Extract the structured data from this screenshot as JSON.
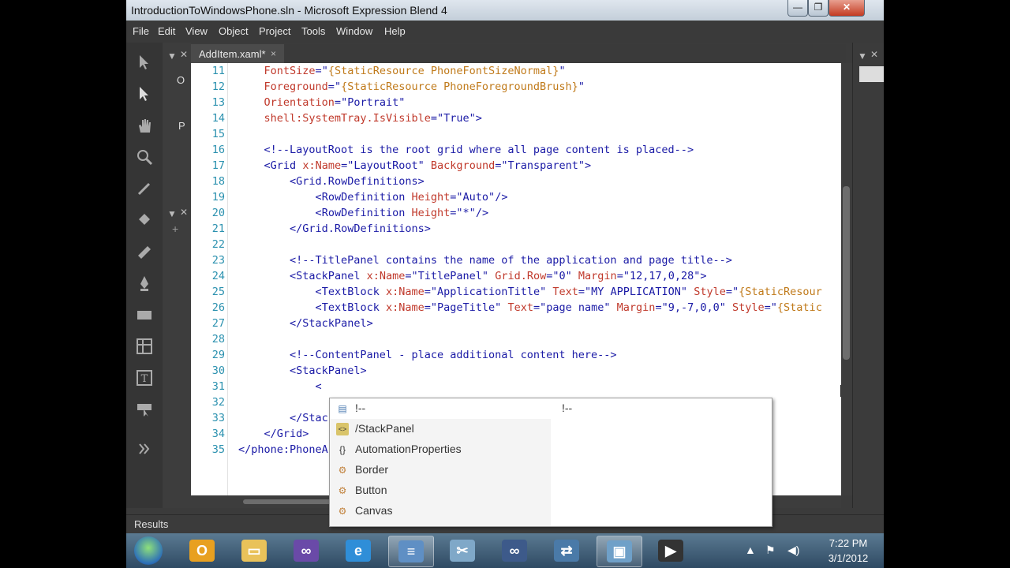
{
  "window": {
    "title": "IntroductionToWindowsPhone.sln - Microsoft Expression Blend 4",
    "controls": {
      "minimize": "—",
      "maximize": "❐",
      "close": "✕"
    }
  },
  "menu": [
    "File",
    "Edit",
    "View",
    "Object",
    "Project",
    "Tools",
    "Window",
    "Help"
  ],
  "left_panel": {
    "letter_1": "O",
    "letter_2": "P",
    "add": "+"
  },
  "document_tab": {
    "label": "AddItem.xaml*",
    "close": "×"
  },
  "code_lines": [
    {
      "num": "11",
      "text": "    FontSize=\"{StaticResource PhoneFontSizeNormal}\""
    },
    {
      "num": "12",
      "text": "    Foreground=\"{StaticResource PhoneForegroundBrush}\""
    },
    {
      "num": "13",
      "text": "    Orientation=\"Portrait\""
    },
    {
      "num": "14",
      "text": "    shell:SystemTray.IsVisible=\"True\">"
    },
    {
      "num": "15",
      "text": ""
    },
    {
      "num": "16",
      "text": "    <!--LayoutRoot is the root grid where all page content is placed-->"
    },
    {
      "num": "17",
      "text": "    <Grid x:Name=\"LayoutRoot\" Background=\"Transparent\">"
    },
    {
      "num": "18",
      "text": "        <Grid.RowDefinitions>"
    },
    {
      "num": "19",
      "text": "            <RowDefinition Height=\"Auto\"/>"
    },
    {
      "num": "20",
      "text": "            <RowDefinition Height=\"*\"/>"
    },
    {
      "num": "21",
      "text": "        </Grid.RowDefinitions>"
    },
    {
      "num": "22",
      "text": ""
    },
    {
      "num": "23",
      "text": "        <!--TitlePanel contains the name of the application and page title-->"
    },
    {
      "num": "24",
      "text": "        <StackPanel x:Name=\"TitlePanel\" Grid.Row=\"0\" Margin=\"12,17,0,28\">"
    },
    {
      "num": "25",
      "text": "            <TextBlock x:Name=\"ApplicationTitle\" Text=\"MY APPLICATION\" Style=\"{StaticResour"
    },
    {
      "num": "26",
      "text": "            <TextBlock x:Name=\"PageTitle\" Text=\"page name\" Margin=\"9,-7,0,0\" Style=\"{Static"
    },
    {
      "num": "27",
      "text": "        </StackPanel>"
    },
    {
      "num": "28",
      "text": ""
    },
    {
      "num": "29",
      "text": "        <!--ContentPanel - place additional content here-->"
    },
    {
      "num": "30",
      "text": "        <StackPanel>"
    },
    {
      "num": "31",
      "text": "            <"
    },
    {
      "num": "32",
      "text": ""
    },
    {
      "num": "33",
      "text": "        </Stac"
    },
    {
      "num": "34",
      "text": "    </Grid>"
    },
    {
      "num": "35",
      "text": "</phone:PhoneA"
    }
  ],
  "intellisense": {
    "preview": "!--",
    "items": [
      {
        "label": "!--",
        "icon": "comment-icon"
      },
      {
        "label": "/StackPanel",
        "icon": "close-tag-icon"
      },
      {
        "label": "AutomationProperties",
        "icon": "braces-icon"
      },
      {
        "label": "Border",
        "icon": "control-icon"
      },
      {
        "label": "Button",
        "icon": "control-icon"
      },
      {
        "label": "Canvas",
        "icon": "control-icon"
      }
    ],
    "selected_index": 0
  },
  "results": {
    "label": "Results"
  },
  "taskbar": {
    "apps": [
      "outlook-icon",
      "explorer-icon",
      "visual-studio-icon",
      "ie-icon",
      "notepad-icon",
      "snipping-icon",
      "vs-express-icon",
      "remote-icon",
      "blend-icon",
      "camera-icon"
    ],
    "clock_time": "7:22 PM",
    "clock_date": "3/1/2012"
  },
  "colors": {
    "code_tag": "#1a1aa6",
    "code_attr": "#c0392b",
    "code_resource": "#c07a1a",
    "line_number": "#2b91af",
    "chrome": "#3b3b3b"
  }
}
